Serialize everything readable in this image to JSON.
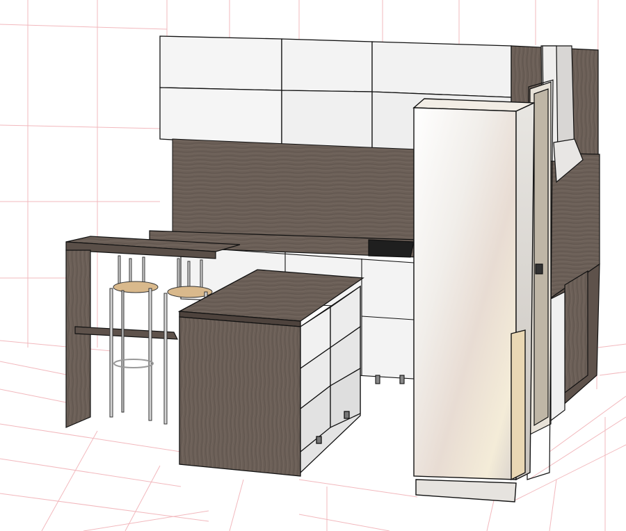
{
  "viewport": {
    "background": "#ffffff",
    "grid_color": "#f2b8bd"
  },
  "scene": {
    "colors": {
      "wood": "#6e625a",
      "wood_dark": "#4e433d",
      "wood_light": "#8b7f76",
      "white_panel": "#f4f4f4",
      "white_panel_shade": "#dcdcdc",
      "edge": "#111111",
      "metal": "#c8c8c8",
      "stool_seat": "#d8b88b",
      "hob": "#2a2a2a",
      "fridge": "#f7f5f2",
      "fridge_shade": "#d9cfc7"
    }
  }
}
